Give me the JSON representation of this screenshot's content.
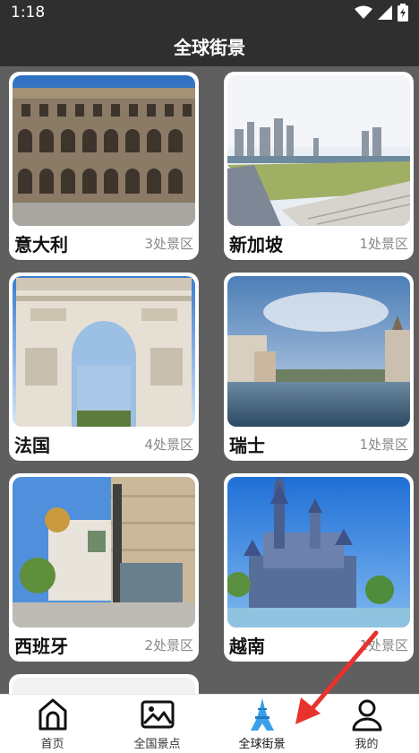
{
  "status": {
    "time": "1:18"
  },
  "app_bar": {
    "title": "全球街景"
  },
  "countries": [
    {
      "name": "意大利",
      "count": "3处景区",
      "scene": "colosseum"
    },
    {
      "name": "新加坡",
      "count": "1处景区",
      "scene": "city"
    },
    {
      "name": "法国",
      "count": "4处景区",
      "scene": "arch"
    },
    {
      "name": "瑞士",
      "count": "1处景区",
      "scene": "lake"
    },
    {
      "name": "西班牙",
      "count": "2处景区",
      "scene": "street"
    },
    {
      "name": "越南",
      "count": "1处景区",
      "scene": "castle"
    }
  ],
  "tabs": [
    {
      "label": "首页",
      "icon": "home-icon",
      "active": false
    },
    {
      "label": "全国景点",
      "icon": "image-icon",
      "active": false
    },
    {
      "label": "全球街景",
      "icon": "tower-icon",
      "active": true
    },
    {
      "label": "我的",
      "icon": "person-icon",
      "active": false
    }
  ],
  "colors": {
    "bar": "#2f2f2f",
    "background": "#5f5f5f",
    "active_tab": "#3aa0e8",
    "annotation": "#e8322e"
  }
}
